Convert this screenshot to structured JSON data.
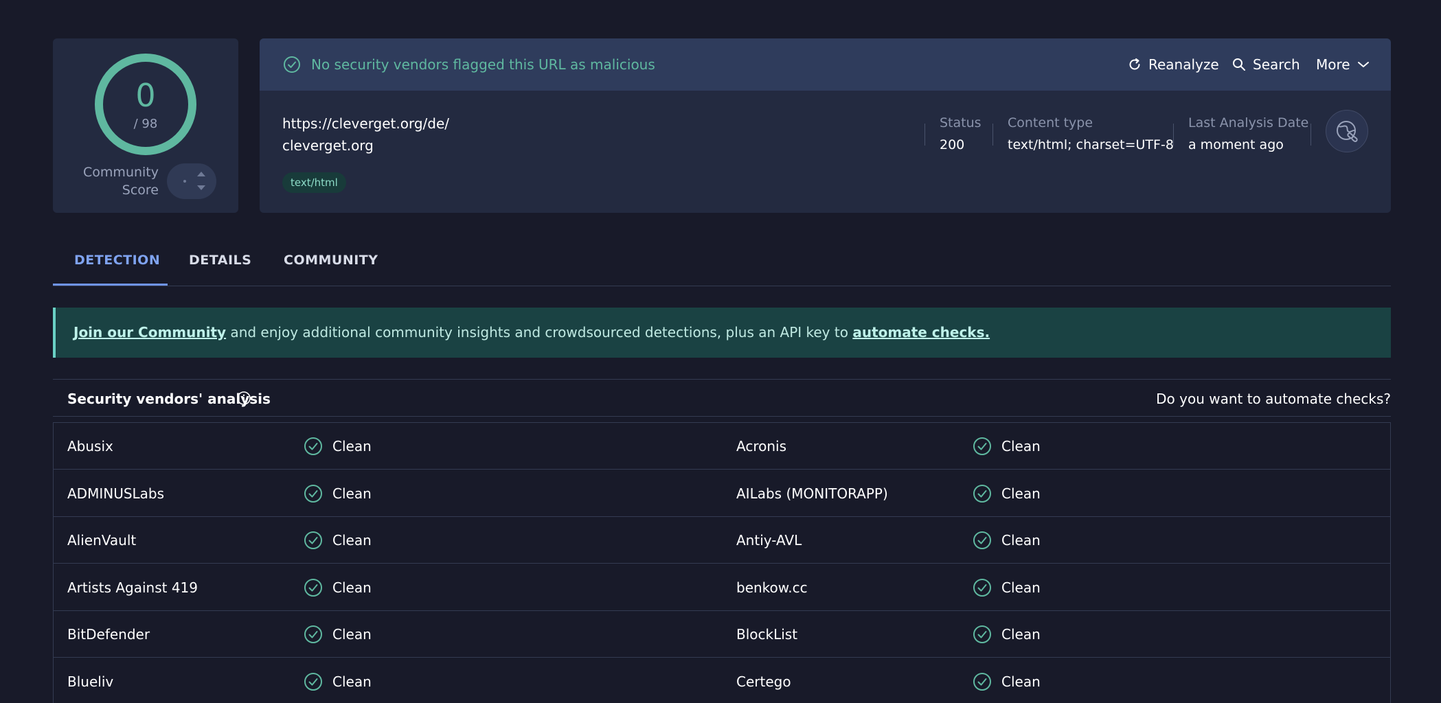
{
  "score": {
    "detections": "0",
    "total": "/ 98",
    "community_label_line1": "Community",
    "community_label_line2": "Score",
    "gauge_color": "#5fb8a0"
  },
  "verdict": {
    "text": "No security vendors flagged this URL as malicious",
    "icon": "check-circle-icon",
    "color": "#5fb8a0"
  },
  "actions": {
    "reanalyze": "Reanalyze",
    "search": "Search",
    "more": "More"
  },
  "url": {
    "full": "https://cleverget.org/de/",
    "domain": "cleverget.org",
    "tag": "text/html"
  },
  "meta": {
    "status_label": "Status",
    "status_value": "200",
    "content_type_label": "Content type",
    "content_type_value": "text/html; charset=UTF-8",
    "last_analysis_label": "Last Analysis Date",
    "last_analysis_value": "a moment ago"
  },
  "tabs": [
    {
      "label": "DETECTION",
      "active": true
    },
    {
      "label": "DETAILS",
      "active": false
    },
    {
      "label": "COMMUNITY",
      "active": false
    }
  ],
  "banner": {
    "link1": "Join our Community",
    "middle": " and enjoy additional community insights and crowdsourced detections, plus an API key to ",
    "link2": "automate checks."
  },
  "vendors_section": {
    "title": "Security vendors' analysis",
    "automate_prompt": "Do you want to automate checks?"
  },
  "vendors": [
    {
      "left": "Abusix",
      "left_result": "Clean",
      "right": "Acronis",
      "right_result": "Clean"
    },
    {
      "left": "ADMINUSLabs",
      "left_result": "Clean",
      "right": "AILabs (MONITORAPP)",
      "right_result": "Clean"
    },
    {
      "left": "AlienVault",
      "left_result": "Clean",
      "right": "Antiy-AVL",
      "right_result": "Clean"
    },
    {
      "left": "Artists Against 419",
      "left_result": "Clean",
      "right": "benkow.cc",
      "right_result": "Clean"
    },
    {
      "left": "BitDefender",
      "left_result": "Clean",
      "right": "BlockList",
      "right_result": "Clean"
    },
    {
      "left": "Blueliv",
      "left_result": "Clean",
      "right": "Certego",
      "right_result": "Clean"
    }
  ]
}
